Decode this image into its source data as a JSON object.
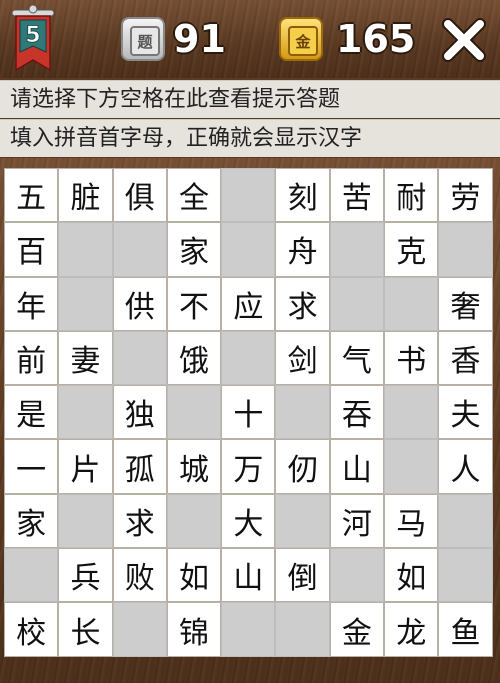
{
  "header": {
    "level": "5",
    "question_icon_label": "题",
    "question_count": "91",
    "coin_icon_label": "金",
    "coin_count": "165",
    "close_label": "✕"
  },
  "hints": {
    "line1": "请选择下方空格在此查看提示答题",
    "line2": "填入拼音首字母，正确就会显示汉字"
  },
  "colors": {
    "wood": "#5c3a22",
    "hint_bg": "#e6e2dc",
    "filled_cell": "#ffffff",
    "empty_cell": "#cdcdcd",
    "coin_gold": "#f6cf4a",
    "badge_teal": "#2f7a78",
    "badge_red": "#c8342a"
  },
  "grid": {
    "rows": [
      [
        "五",
        "脏",
        "俱",
        "全",
        "",
        "刻",
        "苦",
        "耐",
        "劳"
      ],
      [
        "百",
        "",
        "",
        "家",
        "",
        "舟",
        "",
        "克",
        ""
      ],
      [
        "年",
        "",
        "供",
        "不",
        "应",
        "求",
        "",
        "",
        "奢"
      ],
      [
        "前",
        "妻",
        "",
        "饿",
        "",
        "剑",
        "气",
        "书",
        "香"
      ],
      [
        "是",
        "",
        "独",
        "",
        "十",
        "",
        "吞",
        "",
        "夫"
      ],
      [
        "一",
        "片",
        "孤",
        "城",
        "万",
        "仞",
        "山",
        "",
        "人"
      ],
      [
        "家",
        "",
        "求",
        "",
        "大",
        "",
        "河",
        "马",
        ""
      ],
      [
        "",
        "兵",
        "败",
        "如",
        "山",
        "倒",
        "",
        "如",
        ""
      ],
      [
        "校",
        "长",
        "",
        "锦",
        "",
        "",
        "金",
        "龙",
        "鱼"
      ]
    ]
  }
}
